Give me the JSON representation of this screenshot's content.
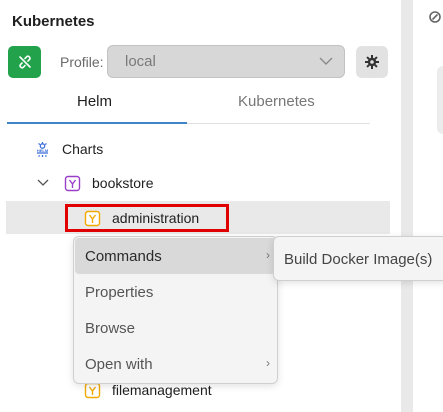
{
  "panel": {
    "title": "Kubernetes"
  },
  "profile": {
    "label": "Profile:",
    "value": "local"
  },
  "tabs": [
    {
      "label": "Helm",
      "active": true
    },
    {
      "label": "Kubernetes",
      "active": false
    }
  ],
  "tree": {
    "root": {
      "label": "Charts",
      "icon": "helm-icon"
    },
    "chart": {
      "label": "bookstore",
      "icon": "chart-icon",
      "expanded": true
    },
    "children": [
      {
        "label": "administration",
        "icon": "chart-icon",
        "selected": true
      },
      {
        "label": "filemanagement",
        "icon": "chart-icon",
        "selected": false
      }
    ]
  },
  "context_menu": {
    "items": [
      {
        "label": "Commands",
        "has_submenu": true,
        "active": true
      },
      {
        "label": "Properties",
        "has_submenu": false
      },
      {
        "label": "Browse",
        "has_submenu": false
      },
      {
        "label": "Open with",
        "has_submenu": true
      }
    ],
    "submenu": {
      "items": [
        {
          "label": "Build Docker Image(s)"
        }
      ]
    }
  },
  "colors": {
    "connect_button": "#21a24b",
    "tab_underline": "#3f85c7",
    "highlight": "#e00000",
    "chart_icon": "#f2a900",
    "helm_icon": "#3f6fd8"
  }
}
